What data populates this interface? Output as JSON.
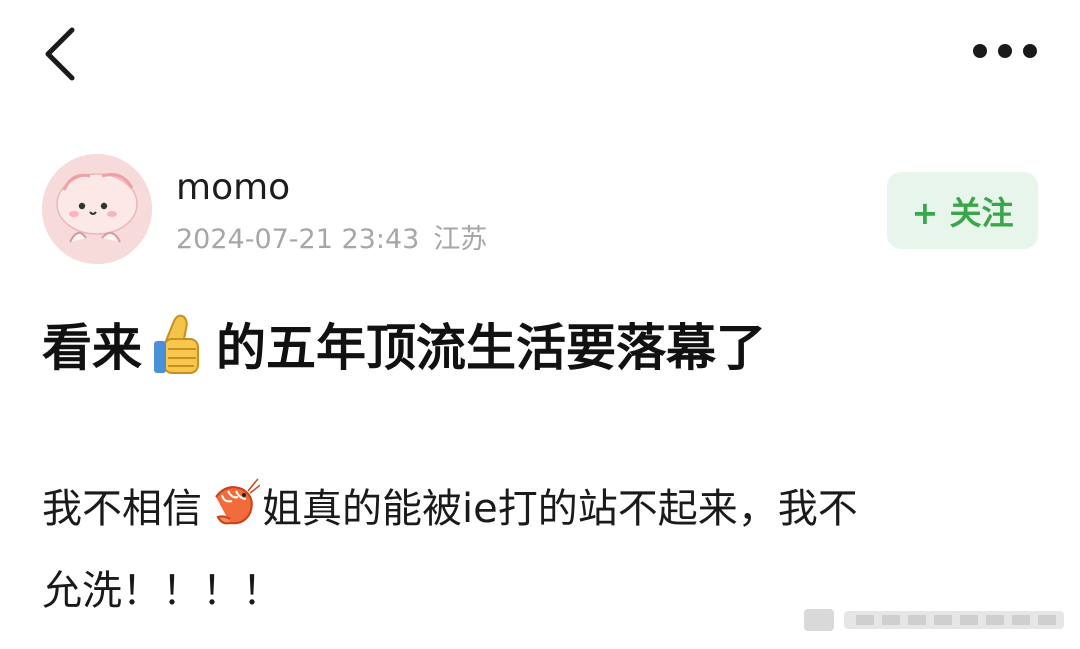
{
  "nav": {
    "back_icon": "chevron-left-icon",
    "more_icon": "more-dots-icon"
  },
  "author": {
    "name": "momo",
    "date": "2024-07-21 23:43",
    "location": "江苏",
    "avatar_icon": "cartoon-avatar"
  },
  "follow": {
    "label": "+ 关注",
    "color": "#3aa64b",
    "background": "#e8f5ea"
  },
  "post": {
    "title_part1": "看来",
    "title_emoji": "thumbs-up-emoji",
    "title_part2": "的五年顶流生活要落幕了",
    "body_line1_part1": "我不相信",
    "body_emoji": "shrimp-emoji",
    "body_line1_part2": "姐真的能被ie打的站不起来，我不",
    "body_line2": "允洗！！！！"
  },
  "watermark_icon": "blurred-watermark"
}
